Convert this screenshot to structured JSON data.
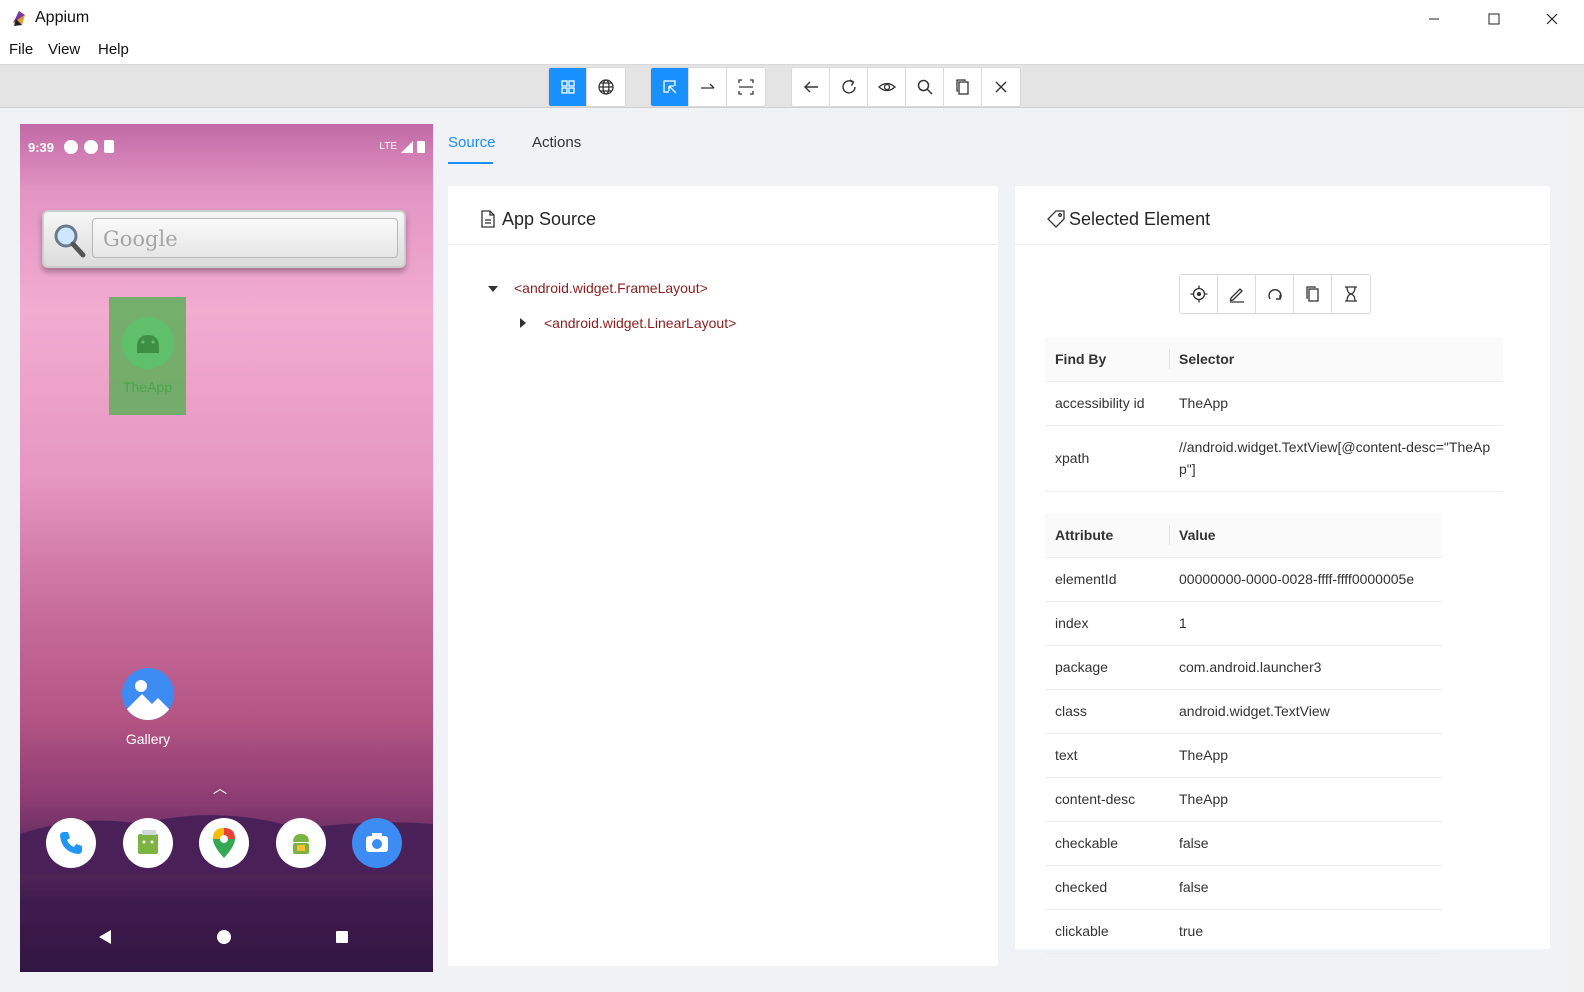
{
  "window": {
    "title": "Appium"
  },
  "menu": [
    "File",
    "View",
    "Help"
  ],
  "toolbar": {
    "groups": [
      [
        "grid-icon",
        "globe-icon"
      ],
      [
        "select-icon",
        "swipe-icon",
        "tap-coordinates-icon"
      ],
      [
        "back-icon",
        "refresh-icon",
        "eye-icon",
        "search-icon",
        "copy-icon",
        "close-icon"
      ]
    ]
  },
  "device": {
    "time": "9:39",
    "network": "LTE",
    "search_placeholder": "Google",
    "app_label": "TheApp",
    "gallery_label": "Gallery"
  },
  "tabs": [
    {
      "label": "Source",
      "active": true
    },
    {
      "label": "Actions",
      "active": false
    }
  ],
  "source": {
    "title": "App Source",
    "nodes": [
      {
        "label": "<android.widget.FrameLayout>",
        "expanded": true
      },
      {
        "label": "<android.widget.LinearLayout>",
        "expanded": false
      }
    ]
  },
  "selected": {
    "title": "Selected Element",
    "find_headers": [
      "Find By",
      "Selector"
    ],
    "find_rows": [
      [
        "accessibility id",
        "TheApp"
      ],
      [
        "xpath",
        "//android.widget.TextView[@content-desc=\"TheApp\"]"
      ]
    ],
    "attr_headers": [
      "Attribute",
      "Value"
    ],
    "attr_rows": [
      [
        "elementId",
        "00000000-0000-0028-ffff-ffff0000005e"
      ],
      [
        "index",
        "1"
      ],
      [
        "package",
        "com.android.launcher3"
      ],
      [
        "class",
        "android.widget.TextView"
      ],
      [
        "text",
        "TheApp"
      ],
      [
        "content-desc",
        "TheApp"
      ],
      [
        "checkable",
        "false"
      ],
      [
        "checked",
        "false"
      ],
      [
        "clickable",
        "true"
      ]
    ]
  },
  "colors": {
    "accent": "#1890ff",
    "tree_tag": "#8a1f1f"
  }
}
